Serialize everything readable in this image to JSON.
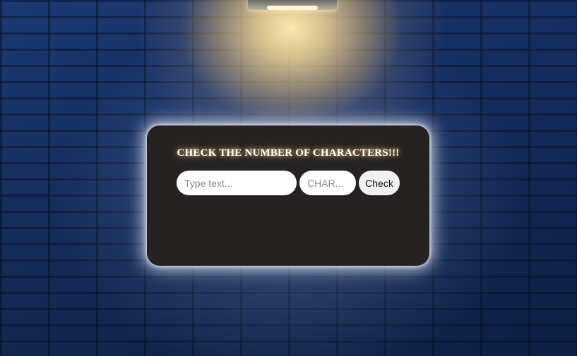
{
  "card": {
    "title": "CHECK THE NUMBER OF CHARACTERS!!!"
  },
  "form": {
    "text_input": {
      "placeholder": "Type text...",
      "value": ""
    },
    "char_input": {
      "placeholder": "CHAR...",
      "value": ""
    },
    "check_button_label": "Check"
  }
}
